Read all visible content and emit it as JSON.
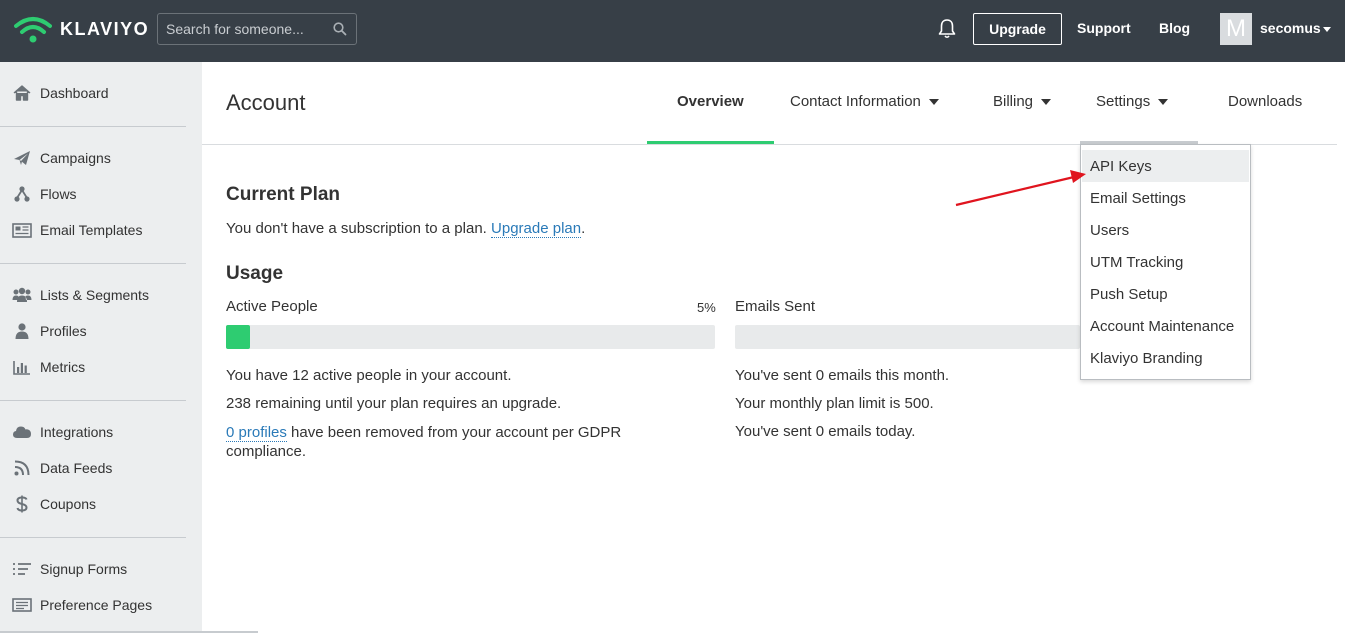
{
  "app": {
    "logo_text": "KLAVIYO",
    "colors": {
      "topbar": "#373f47",
      "accent": "#2ecc71",
      "link": "#2a7ab8",
      "sidebar": "#eceeef",
      "annotation_arrow": "#e0141e"
    }
  },
  "topbar": {
    "search_placeholder": "Search for someone...",
    "upgrade_label": "Upgrade",
    "support_label": "Support",
    "blog_label": "Blog",
    "avatar_letter": "M",
    "username": "secomus"
  },
  "sidebar": {
    "items": [
      {
        "label": "Dashboard",
        "icon": "home-icon"
      },
      {
        "label": "Campaigns",
        "icon": "paper-plane-icon"
      },
      {
        "label": "Flows",
        "icon": "flows-icon"
      },
      {
        "label": "Email Templates",
        "icon": "newspaper-icon"
      },
      {
        "label": "Lists & Segments",
        "icon": "users-icon"
      },
      {
        "label": "Profiles",
        "icon": "user-icon"
      },
      {
        "label": "Metrics",
        "icon": "bar-chart-icon"
      },
      {
        "label": "Integrations",
        "icon": "cloud-icon"
      },
      {
        "label": "Data Feeds",
        "icon": "rss-icon"
      },
      {
        "label": "Coupons",
        "icon": "dollar-icon"
      },
      {
        "label": "Signup Forms",
        "icon": "list-icon"
      },
      {
        "label": "Preference Pages",
        "icon": "preference-icon"
      }
    ]
  },
  "header": {
    "title": "Account",
    "tabs": [
      {
        "label": "Overview",
        "active": true,
        "has_caret": false
      },
      {
        "label": "Contact Information",
        "active": false,
        "has_caret": true
      },
      {
        "label": "Billing",
        "active": false,
        "has_caret": true
      },
      {
        "label": "Settings",
        "active": false,
        "has_caret": true
      },
      {
        "label": "Downloads",
        "active": false,
        "has_caret": false
      }
    ]
  },
  "plan": {
    "heading": "Current Plan",
    "text": "You don't have a subscription to a plan.",
    "link": "Upgrade plan",
    "period": "."
  },
  "usage": {
    "heading": "Usage",
    "active_people": {
      "label": "Active People",
      "percent_label": "5%",
      "fill_fraction": 0.05,
      "line1": "You have 12 active people in your account.",
      "line2": "238 remaining until your plan requires an upgrade.",
      "gdpr_link": "0 profiles",
      "gdpr_text": "have been removed from your account per GDPR",
      "gdpr_text2": "compliance."
    },
    "emails_sent": {
      "label": "Emails Sent",
      "fill_fraction": 0,
      "line1": "You've sent 0 emails this month.",
      "line2": "Your monthly plan limit is 500.",
      "line3": "You've sent 0 emails today."
    }
  },
  "settings_menu": {
    "items": [
      "API Keys",
      "Email Settings",
      "Users",
      "UTM Tracking",
      "Push Setup",
      "Account Maintenance",
      "Klaviyo Branding"
    ],
    "highlighted": "API Keys"
  }
}
